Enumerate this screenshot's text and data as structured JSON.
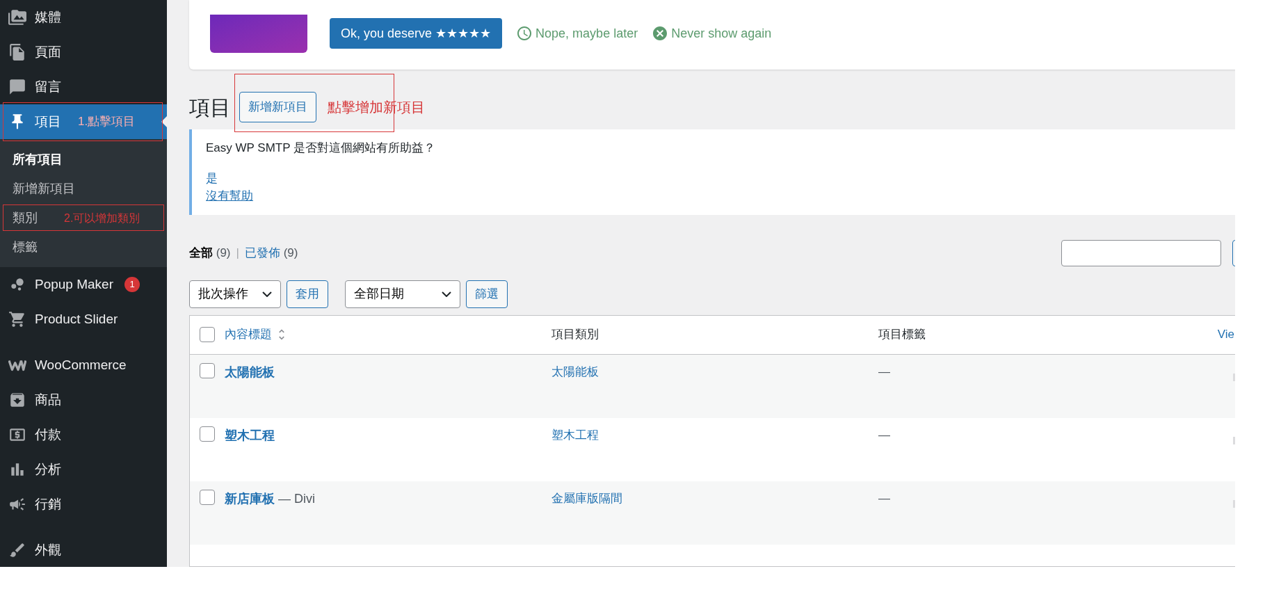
{
  "sidebar": {
    "items": [
      {
        "label": "媒體",
        "selected": false
      },
      {
        "label": "頁面",
        "selected": false
      },
      {
        "label": "留言",
        "selected": false
      },
      {
        "label": "項目",
        "selected": true,
        "annotation": "1.點擊項目",
        "submenu": [
          {
            "label": "所有項目",
            "selected": true
          },
          {
            "label": "新增新項目",
            "selected": false
          },
          {
            "label": "類別",
            "selected": false,
            "annotation": "2.可以增加類別"
          },
          {
            "label": "標籤",
            "selected": false
          }
        ]
      },
      {
        "label": "Popup Maker",
        "selected": false,
        "badge": "1"
      },
      {
        "label": "Product Slider",
        "selected": false
      },
      {
        "label": "WooCommerce",
        "selected": false
      },
      {
        "label": "商品",
        "selected": false
      },
      {
        "label": "付款",
        "selected": false
      },
      {
        "label": "分析",
        "selected": false
      },
      {
        "label": "行銷",
        "selected": false
      },
      {
        "label": "外觀",
        "selected": false
      }
    ]
  },
  "review_notice": {
    "button": "Ok, you deserve ★★★★★",
    "links": [
      {
        "kind": "later",
        "label": "Nope, maybe later"
      },
      {
        "kind": "never",
        "label": "Never show again"
      }
    ]
  },
  "page": {
    "title": "項目",
    "add_button": "新增新項目",
    "annotation": "點擊增加新項目"
  },
  "smtp_notice": {
    "question": "Easy WP SMTP 是否對這個網站有所助益？",
    "links": [
      "是",
      "沒有幫助"
    ]
  },
  "views": [
    {
      "label": "全部",
      "count": "(9)",
      "selected": true
    },
    {
      "label": "已發佈",
      "count": "(9)",
      "selected": false
    }
  ],
  "views_separator": "|",
  "toolbar": {
    "bulk_select": "批次操作",
    "apply": "套用",
    "date_select": "全部日期",
    "filter": "篩選"
  },
  "table": {
    "all_checked": false,
    "columns": [
      "內容標題",
      "項目類別",
      "項目標籤",
      "Vie"
    ],
    "rows": [
      {
        "title": "太陽能板",
        "checked": false,
        "category": "太陽能板",
        "tags": "—"
      },
      {
        "title": "塑木工程",
        "checked": false,
        "category": "塑木工程",
        "tags": "—"
      },
      {
        "title": "新店庫板",
        "suffix": "— Divi",
        "checked": false,
        "category": "金屬庫版隔間",
        "tags": "—"
      }
    ]
  }
}
